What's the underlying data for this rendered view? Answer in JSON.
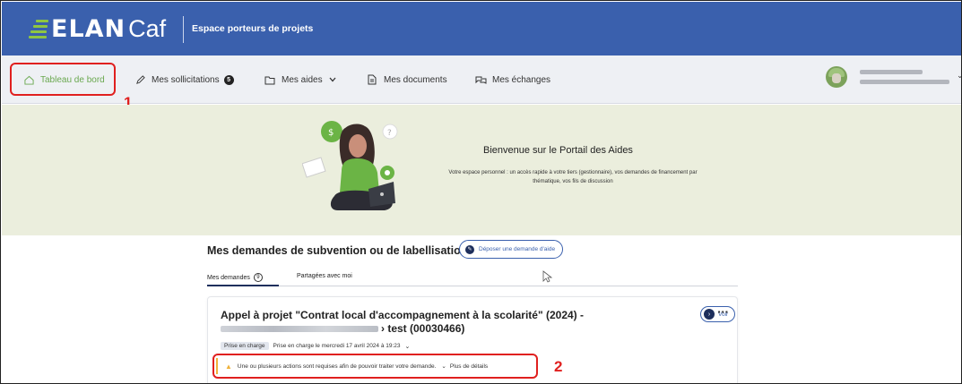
{
  "header": {
    "logo_bold": "ELAN",
    "logo_light": "Caf",
    "subtitle": "Espace porteurs de projets",
    "brand_color": "#3a60ad",
    "accent_color": "#8fc641"
  },
  "nav": {
    "items": [
      {
        "label": "Tableau de bord",
        "icon": "home-icon",
        "active": true
      },
      {
        "label": "Mes sollicitations",
        "icon": "pencil-icon",
        "badge": "5"
      },
      {
        "label": "Mes aides",
        "icon": "folder-icon",
        "dropdown": true
      },
      {
        "label": "Mes documents",
        "icon": "document-icon"
      },
      {
        "label": "Mes échanges",
        "icon": "chat-icon"
      }
    ]
  },
  "annotations": {
    "marker1": "1",
    "marker2": "2",
    "color": "#e0201f"
  },
  "hero": {
    "title": "Bienvenue sur le Portail des Aides",
    "description": "Votre espace personnel : un accès rapide à votre tiers (gestionnaire), vos demandes de financement par thématique, vos fils de discussion"
  },
  "main": {
    "title": "Mes demandes de subvention ou de labellisation",
    "deposit_button": "Déposer une demande d'aide",
    "tabs": [
      {
        "label": "Mes demandes",
        "count": "9",
        "active": true
      },
      {
        "label": "Partagées avec moi"
      }
    ]
  },
  "card": {
    "title_line1": "Appel à projet \"Contrat local d'accompagnement à la scolarité\" (2024) -",
    "title_line2_suffix": "› test (00030466)",
    "view_button": "Voir",
    "more_button": "···",
    "status_tag": "Prise en charge",
    "status_text": "Prise en charge le mercredi 17 avril 2024 à 19:23",
    "alert_text": "Une ou plusieurs actions sont requises afin de pouvoir traiter votre demande.",
    "alert_more": "Plus de détails"
  }
}
